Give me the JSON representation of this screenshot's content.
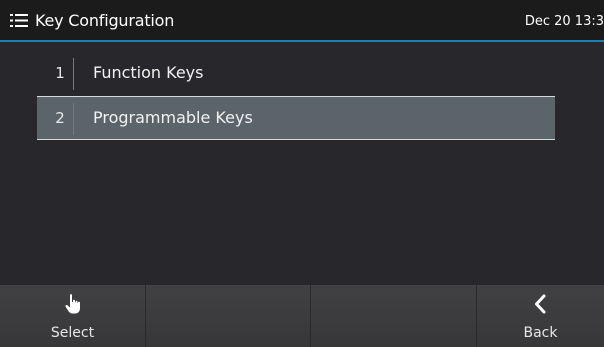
{
  "header": {
    "title": "Key Configuration",
    "datetime": "Dec 20 13:3",
    "menu_icon": "list-menu-icon",
    "accent_color": "#1f7fb3"
  },
  "menu": {
    "items": [
      {
        "number": "1",
        "label": "Function Keys",
        "selected": false
      },
      {
        "number": "2",
        "label": "Programmable Keys",
        "selected": true
      }
    ]
  },
  "softkeys": [
    {
      "label": "Select",
      "icon": "hand-pointer-icon"
    },
    {
      "label": "",
      "icon": ""
    },
    {
      "label": "",
      "icon": ""
    },
    {
      "label": "Back",
      "icon": "chevron-left-icon"
    }
  ]
}
